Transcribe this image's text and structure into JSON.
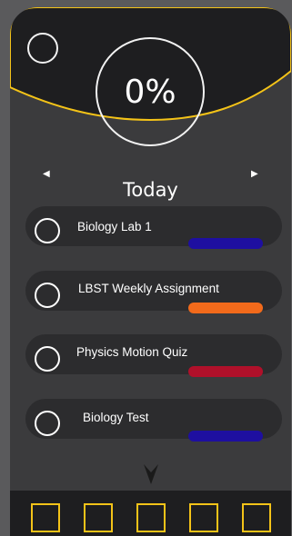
{
  "header": {
    "progress": "0%",
    "accent_color": "#f4c318",
    "header_bg": "#1e1e20"
  },
  "navigation": {
    "day_label": "Today",
    "prev_icon": "triangle-left-icon",
    "next_icon": "triangle-right-icon"
  },
  "tasks": [
    {
      "label": "Biology Lab 1",
      "color": "#1e0fa0"
    },
    {
      "label": "LBST Weekly Assignment",
      "color": "#f26a1b"
    },
    {
      "label": "Physics Motion Quiz",
      "color": "#b0102a"
    },
    {
      "label": "Biology Test",
      "color": "#1e0fa0"
    }
  ],
  "footer": {
    "scroll_icon": "chevron-down-icon",
    "tab_count": 5
  }
}
